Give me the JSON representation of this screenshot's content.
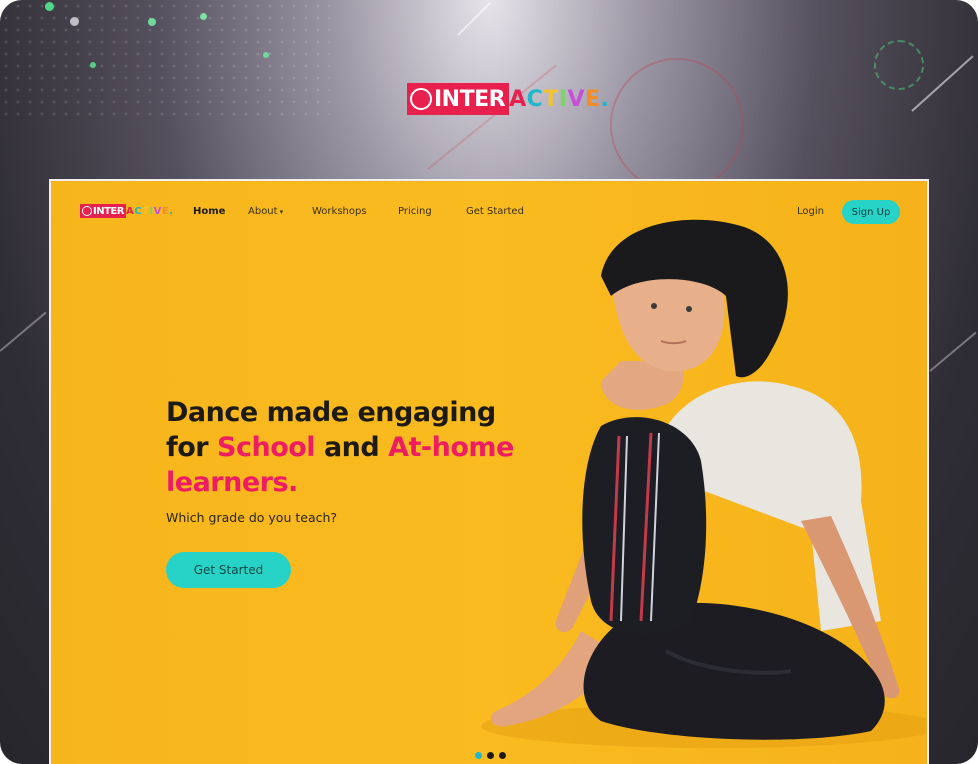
{
  "brand": {
    "logo_primary": "INTER",
    "logo_secondary": "ACTIVE.",
    "colors": {
      "brand_pink": "#ee1d63",
      "accent_teal": "#27d3c6",
      "hero_yellow": "#f9bb1f",
      "text_dark": "#1d1a14"
    }
  },
  "nav": {
    "links": [
      {
        "label": "Home"
      },
      {
        "label": "About"
      },
      {
        "label": "Workshops"
      },
      {
        "label": "Pricing"
      },
      {
        "label": "Get Started"
      }
    ],
    "login_label": "Login",
    "signup_label": "Sign Up"
  },
  "hero": {
    "title_line1": "Dance made engaging",
    "title_line2_prefix": "for ",
    "title_highlight1": "School",
    "title_line2_mid": " and ",
    "title_highlight2": "At-home",
    "title_line3": "learners.",
    "subtitle": "Which grade do you teach?",
    "cta_label": "Get Started",
    "image_subject": "boy in black beanie and white t-shirt sitting cross-legged"
  },
  "slider": {
    "total": 3,
    "active_index": 1
  },
  "icons": [
    "globe-icon",
    "chevron-down-icon"
  ]
}
